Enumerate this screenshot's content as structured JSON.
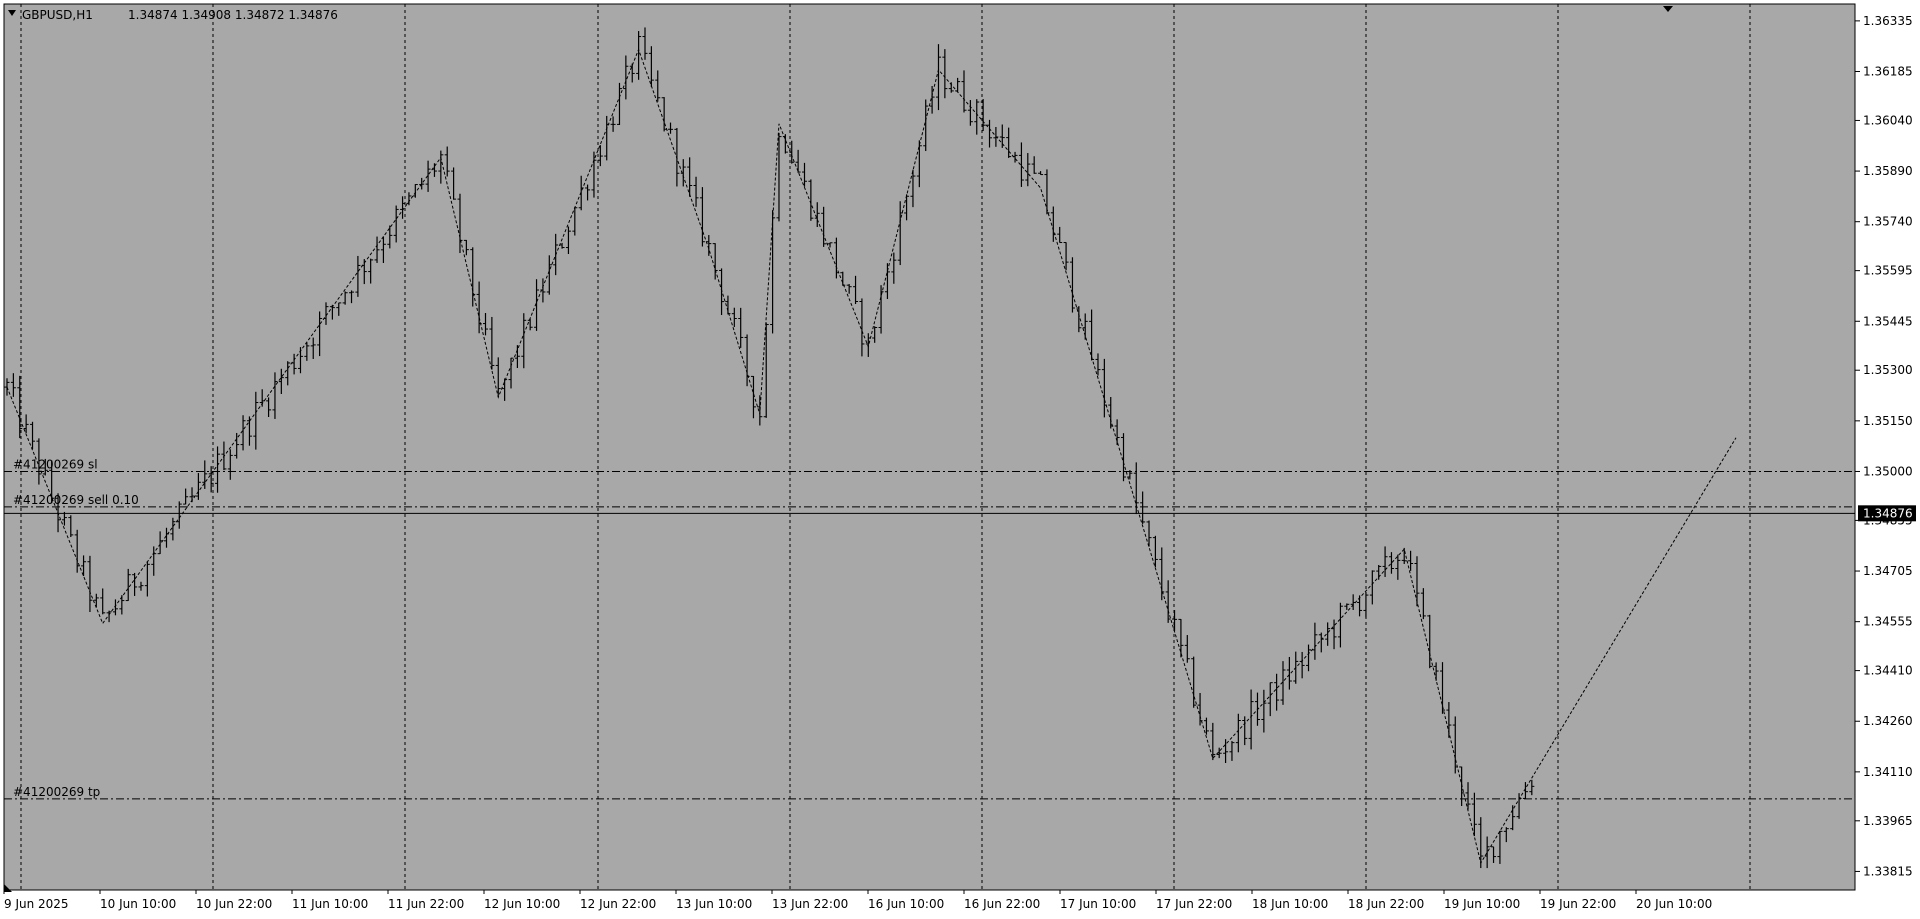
{
  "header": {
    "symbol": "GBPUSD,H1",
    "ohlc": "1.34874 1.34908 1.34872 1.34876"
  },
  "current_price_label": "1.34876",
  "orders": [
    {
      "label": "#41200269 sl",
      "price": 1.35
    },
    {
      "label": "#41200269 sell 0.10",
      "price": 1.34895
    },
    {
      "label": "#41200269 tp",
      "price": 1.3403
    }
  ],
  "colors": {
    "background": "#a8a8a8",
    "foreground": "#000000",
    "tag_bg": "#000000",
    "tag_text": "#ffffff"
  },
  "chart_data": {
    "type": "bar",
    "bar_style": "ohlc",
    "symbol": "GBPUSD",
    "timeframe": "H1",
    "ylim": [
      1.3376,
      1.36385
    ],
    "y_ticks": [
      "1.36335",
      "1.36185",
      "1.36040",
      "1.35890",
      "1.35740",
      "1.35595",
      "1.35445",
      "1.35300",
      "1.35150",
      "1.35000",
      "1.34855",
      "1.34705",
      "1.34555",
      "1.34410",
      "1.34260",
      "1.34110",
      "1.33965",
      "1.33815"
    ],
    "x_labels": [
      "9 Jun 2025",
      "10 Jun 10:00",
      "10 Jun 22:00",
      "11 Jun 10:00",
      "11 Jun 22:00",
      "12 Jun 10:00",
      "12 Jun 22:00",
      "13 Jun 10:00",
      "13 Jun 22:00",
      "16 Jun 10:00",
      "16 Jun 22:00",
      "17 Jun 10:00",
      "17 Jun 22:00",
      "18 Jun 10:00",
      "18 Jun 22:00",
      "19 Jun 10:00",
      "19 Jun 22:00",
      "20 Jun 10:00"
    ],
    "bar_count": 240,
    "current_price": 1.34876,
    "grid": true,
    "zigzag_pivots": [
      [
        0,
        1.3525
      ],
      [
        15,
        1.3455
      ],
      [
        68,
        1.3593
      ],
      [
        77,
        1.3522
      ],
      [
        99,
        1.3625
      ],
      [
        110,
        1.3566
      ],
      [
        118,
        1.3517
      ],
      [
        121,
        1.3603
      ],
      [
        135,
        1.3537
      ],
      [
        146,
        1.3619
      ],
      [
        162,
        1.3584
      ],
      [
        189,
        1.3415
      ],
      [
        219,
        1.3477
      ],
      [
        231,
        1.3384
      ],
      [
        271,
        1.351
      ]
    ]
  }
}
